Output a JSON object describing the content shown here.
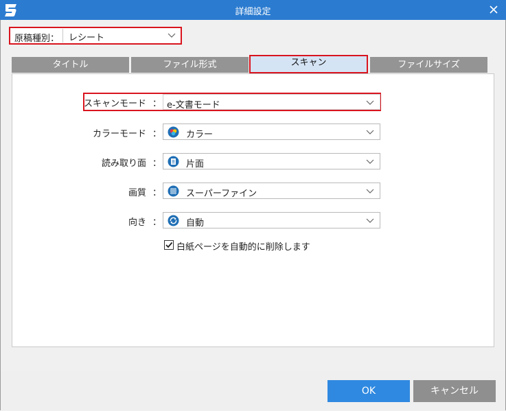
{
  "window": {
    "title": "詳細設定"
  },
  "doc_type": {
    "label": "原稿種別：",
    "value": "レシート"
  },
  "tabs": [
    {
      "label": "タイトル",
      "active": false
    },
    {
      "label": "ファイル形式",
      "active": false
    },
    {
      "label": "スキャン",
      "active": true
    },
    {
      "label": "ファイルサイズ",
      "active": false
    }
  ],
  "scan": {
    "mode": {
      "label": "スキャンモード",
      "colon": "：",
      "value": "e-文書モード"
    },
    "color": {
      "label": "カラーモード",
      "colon": "：",
      "value": "カラー",
      "icon": "color-mode-icon"
    },
    "sides": {
      "label": "読み取り面",
      "colon": "：",
      "value": "片面",
      "icon": "single-side-icon"
    },
    "quality": {
      "label": "画質",
      "colon": "：",
      "value": "スーパーファイン",
      "icon": "quality-icon"
    },
    "orientation": {
      "label": "向き",
      "colon": "：",
      "value": "自動",
      "icon": "auto-rotate-icon"
    },
    "blank_page": {
      "label": "白紙ページを自動的に削除します",
      "checked": true
    }
  },
  "buttons": {
    "ok": "OK",
    "cancel": "キャンセル"
  },
  "colors": {
    "titlebar": "#2b7bd0",
    "highlight": "#d9141e",
    "ok": "#2f89e0",
    "cancel": "#8f8f8f",
    "tab_inactive": "#949494",
    "tab_active": "#d5e4f5"
  }
}
